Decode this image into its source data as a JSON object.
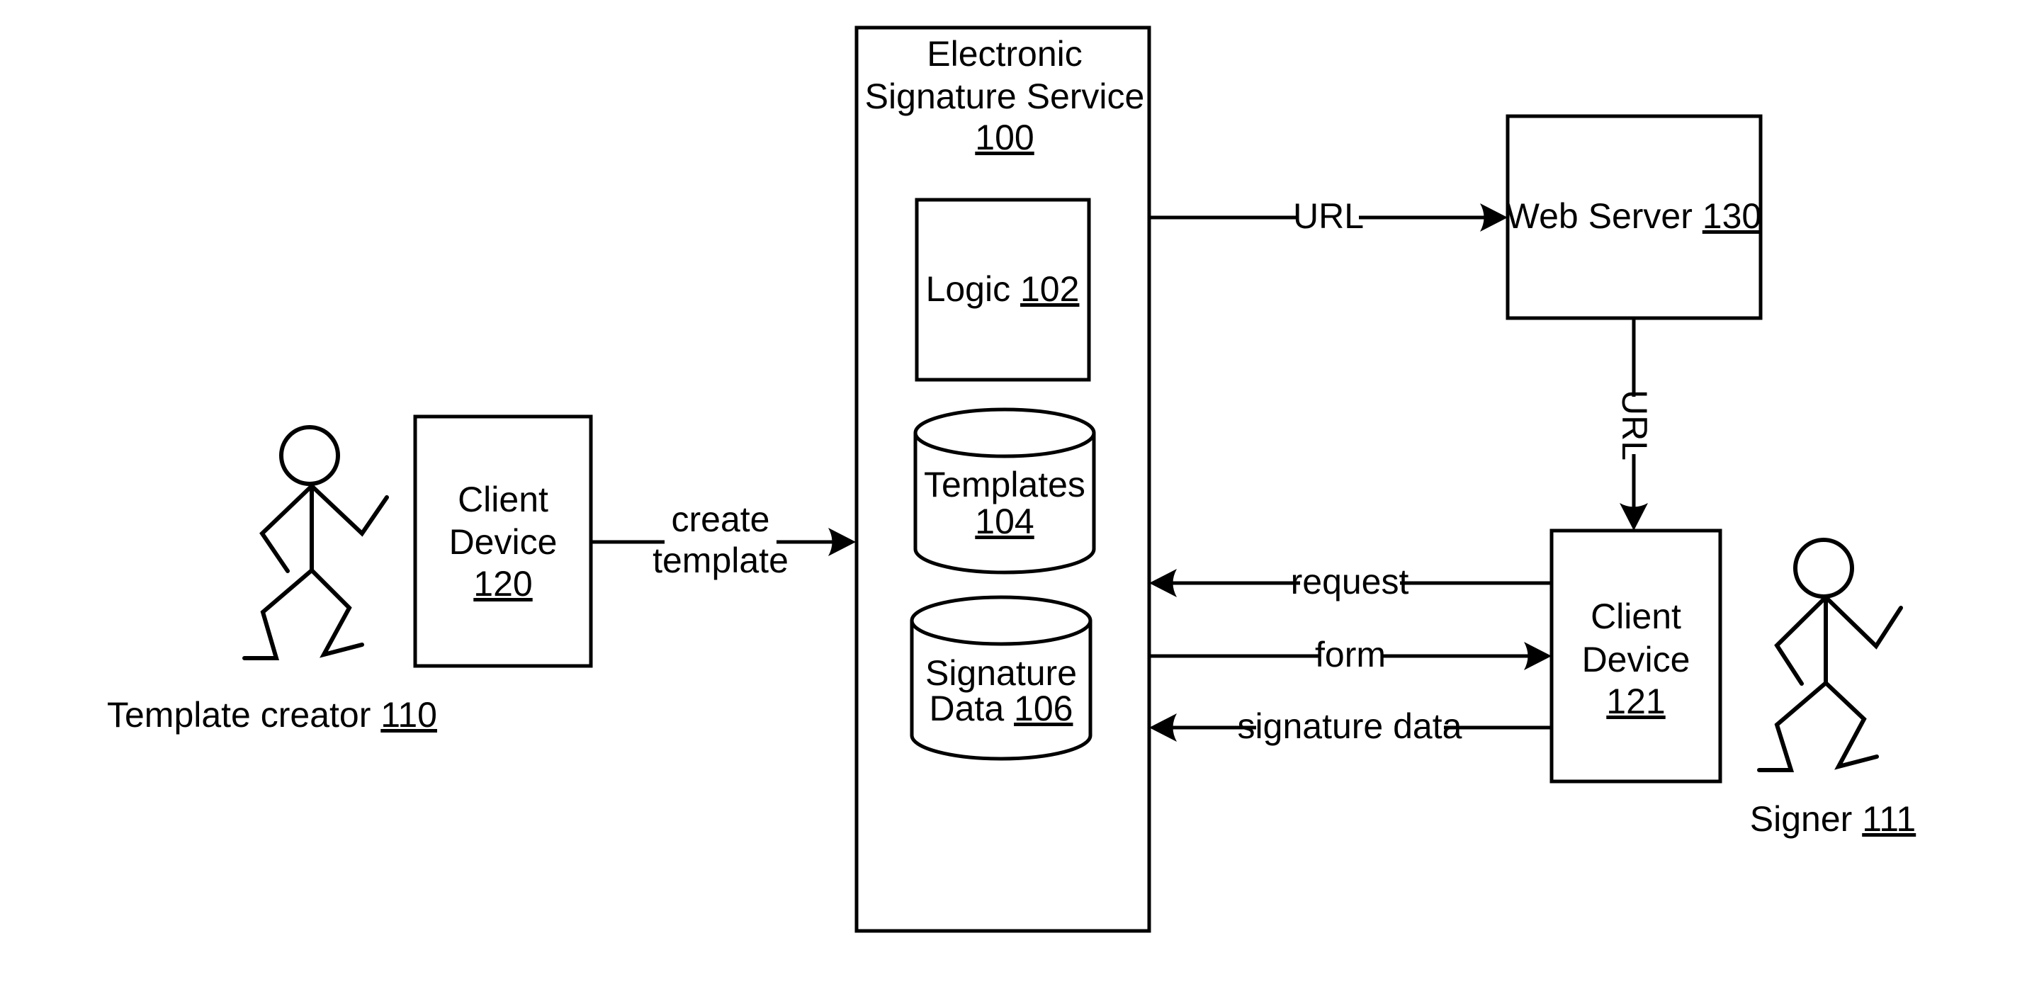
{
  "diagram": {
    "nodes": {
      "service": {
        "lines": [
          "Electronic",
          "Signature Service"
        ],
        "ref": "100"
      },
      "logic": {
        "label": "Logic",
        "ref": "102"
      },
      "templates": {
        "label": "Templates",
        "ref": "104"
      },
      "signature_data": {
        "lines": [
          "Signature",
          "Data"
        ],
        "ref": "106"
      },
      "web_server": {
        "label": "Web Server",
        "ref": "130"
      },
      "client_device_120": {
        "lines": [
          "Client",
          "Device"
        ],
        "ref": "120"
      },
      "client_device_121": {
        "lines": [
          "Client",
          "Device"
        ],
        "ref": "121"
      },
      "template_creator": {
        "label": "Template creator",
        "ref": "110"
      },
      "signer": {
        "label": "Signer",
        "ref": "111"
      }
    },
    "edges": {
      "create_template": {
        "lines": [
          "create",
          "template"
        ],
        "from": "Client Device 120",
        "to": "Electronic Signature Service 100"
      },
      "url_to_web_server": {
        "label": "URL",
        "from": "Electronic Signature Service 100",
        "to": "Web Server 130"
      },
      "url_to_client": {
        "label": "URL",
        "from": "Web Server 130",
        "to": "Client Device 121"
      },
      "request": {
        "label": "request",
        "from": "Client Device 121",
        "to": "Electronic Signature Service 100"
      },
      "form": {
        "label": "form",
        "from": "Electronic Signature Service 100",
        "to": "Client Device 121"
      },
      "signature_data": {
        "label": "signature data",
        "from": "Client Device 121",
        "to": "Electronic Signature Service 100"
      }
    }
  }
}
